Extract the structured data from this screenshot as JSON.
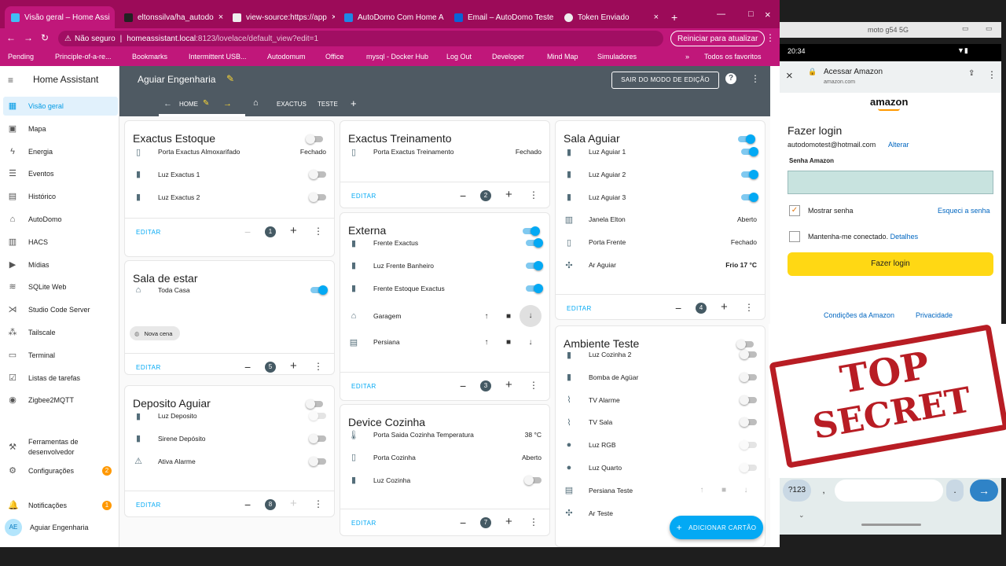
{
  "browser": {
    "tabs": [
      "Visão geral – Home Assi",
      "eltonssilva/ha_autodo",
      "view-source:https://app",
      "AutoDomo Com Home A",
      "Email – AutoDomo Teste",
      "Token Enviado"
    ],
    "url_insecure": "Não seguro",
    "url_host": "homeassistant.local",
    "url_path": ":8123/lovelace/default_view?edit=1",
    "reload_label": "Reiniciar para atualizar",
    "bookmarks": [
      "Pending",
      "Principle-of-a-re...",
      "Bookmarks",
      "Intermittent USB...",
      "Autodomum",
      "Office",
      "mysql - Docker Hub",
      "Log Out",
      "Developer",
      "Mind Map",
      "Simuladores",
      "»",
      "Todos os favoritos"
    ]
  },
  "sidebar": {
    "title": "Home Assistant",
    "items": [
      {
        "label": "Visão geral",
        "icon": "dashboard-icon"
      },
      {
        "label": "Mapa",
        "icon": "map-icon"
      },
      {
        "label": "Energia",
        "icon": "bolt-icon"
      },
      {
        "label": "Eventos",
        "icon": "list-icon"
      },
      {
        "label": "Histórico",
        "icon": "chart-icon"
      },
      {
        "label": "AutoDomo",
        "icon": "home-icon"
      },
      {
        "label": "HACS",
        "icon": "hacs-icon"
      },
      {
        "label": "Mídias",
        "icon": "media-icon"
      },
      {
        "label": "SQLite Web",
        "icon": "database-icon"
      },
      {
        "label": "Studio Code Server",
        "icon": "code-icon"
      },
      {
        "label": "Tailscale",
        "icon": "network-icon"
      },
      {
        "label": "Terminal",
        "icon": "terminal-icon"
      },
      {
        "label": "Listas de tarefas",
        "icon": "todo-icon"
      },
      {
        "label": "Zigbee2MQTT",
        "icon": "zigbee-icon"
      }
    ],
    "dev_tools_1": "Ferramentas de",
    "dev_tools_2": "desenvolvedor",
    "settings": "Configurações",
    "settings_badge": "2",
    "notifications": "Notificações",
    "notifications_badge": "1",
    "user_initials": "AE",
    "user_name": "Aguiar Engenharia"
  },
  "header": {
    "title": "Aguiar Engenharia",
    "exit_edit": "SAIR DO MODO DE EDIÇÃO",
    "tabs": [
      "HOME",
      "EXACTUS",
      "TESTE"
    ]
  },
  "cards": {
    "exactus_estoque": {
      "title": "Exactus Estoque",
      "rows": [
        [
          "Porta Exactus Almoxarifado",
          "Fechado"
        ],
        [
          "Luz Exactus 1",
          ""
        ],
        [
          "Luz Exactus 2",
          ""
        ]
      ],
      "edit": "EDITAR",
      "count": "1"
    },
    "sala_estar": {
      "title": "Sala de estar",
      "rows": [
        [
          "Toda Casa",
          ""
        ]
      ],
      "scene": "Nova cena",
      "edit": "EDITAR",
      "count": "5"
    },
    "deposito": {
      "title": "Deposito Aguiar",
      "rows": [
        [
          "Luz Deposito",
          ""
        ],
        [
          "Sirene Depósito",
          ""
        ],
        [
          "Ativa Alarme",
          ""
        ]
      ],
      "edit": "EDITAR",
      "count": "8"
    },
    "treinamento": {
      "title": "Exactus Treinamento",
      "rows": [
        [
          "Porta Exactus Treinamento",
          "Fechado"
        ]
      ],
      "edit": "EDITAR",
      "count": "2"
    },
    "externa": {
      "title": "Externa",
      "rows": [
        [
          "Frente Exactus",
          ""
        ],
        [
          "Luz Frente Banheiro",
          ""
        ],
        [
          "Frente Estoque Exactus",
          ""
        ],
        [
          "Garagem",
          ""
        ],
        [
          "Persiana",
          ""
        ]
      ],
      "edit": "EDITAR",
      "count": "3"
    },
    "cozinha": {
      "title": "Device Cozinha",
      "rows": [
        [
          "Porta Saida Cozinha Temperatura",
          "38 °C"
        ],
        [
          "Porta Cozinha",
          "Aberto"
        ],
        [
          "Luz Cozinha",
          ""
        ]
      ],
      "edit": "EDITAR",
      "count": "7"
    },
    "sala_aguiar": {
      "title": "Sala Aguiar",
      "rows": [
        [
          "Luz Aguiar 1",
          ""
        ],
        [
          "Luz Aguiar 2",
          ""
        ],
        [
          "Luz Aguiar 3",
          ""
        ],
        [
          "Janela Elton",
          "Aberto"
        ],
        [
          "Porta Frente",
          "Fechado"
        ],
        [
          "Ar Aguiar",
          "Frio 17 °C"
        ]
      ],
      "edit": "EDITAR",
      "count": "4"
    },
    "ambiente": {
      "title": "Ambiente Teste",
      "rows": [
        [
          "Luz Cozinha 2",
          ""
        ],
        [
          "Bomba de Agüar",
          ""
        ],
        [
          "TV Alarme",
          ""
        ],
        [
          "TV Sala",
          ""
        ],
        [
          "Luz RGB",
          ""
        ],
        [
          "Luz Quarto",
          ""
        ],
        [
          "Persiana Teste",
          ""
        ],
        [
          "Ar Teste",
          ""
        ]
      ]
    }
  },
  "add_card": "ADICIONAR CARTÃO",
  "phone": {
    "window_title": "moto g54 5G",
    "time": "20:34",
    "page_title": "Acessar Amazon",
    "page_host": "amazon.com",
    "logo": "amazon",
    "heading": "Fazer login",
    "email": "autodomotest@hotmail.com",
    "change": "Alterar",
    "pw_label": "Senha Amazon",
    "show_pw": "Mostrar senha",
    "forgot": "Esqueci a senha",
    "keep": "Mantenha-me conectado.",
    "details": "Detalhes",
    "login_btn": "Fazer login",
    "terms": "Condições da Amazon",
    "privacy": "Privacidade",
    "key_123": "?123",
    "key_comma": ",",
    "key_dot": "."
  },
  "stamp": {
    "line1": "TOP",
    "line2": "SECRET"
  }
}
